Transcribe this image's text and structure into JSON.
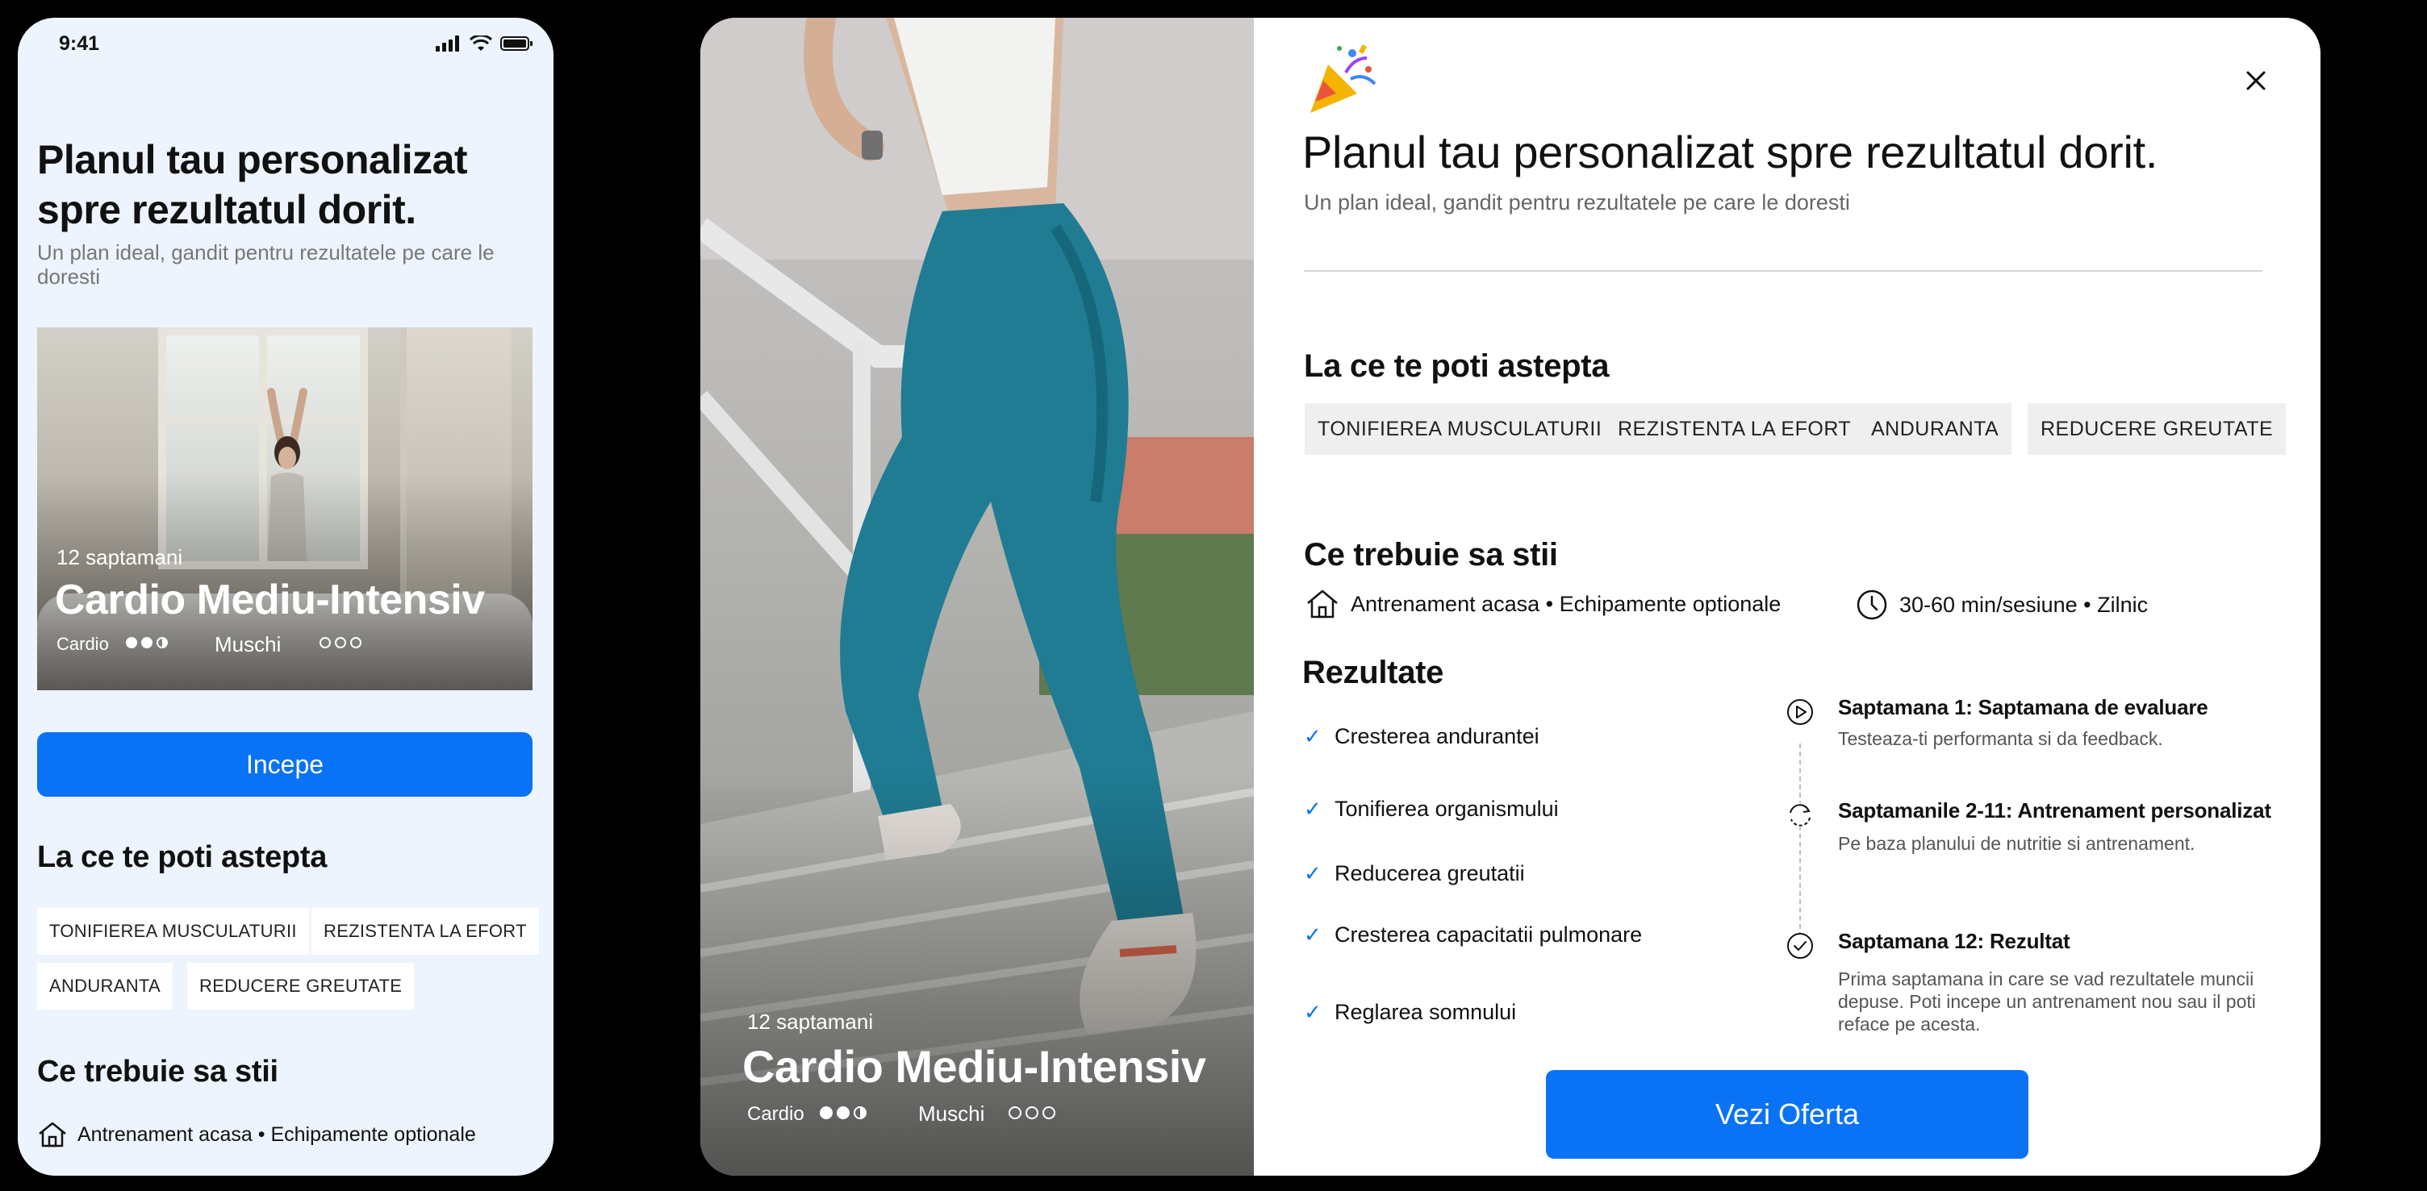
{
  "colors": {
    "accent": "#0a72f5",
    "phone_bg": "#eef4fd",
    "tag_bg": "#efefef"
  },
  "phone": {
    "status": {
      "time": "9:41",
      "icons": [
        "signal-icon",
        "wifi-icon",
        "battery-icon"
      ]
    },
    "title": "Planul tau personalizat spre rezultatul dorit.",
    "subtitle": "Un plan ideal, gandit pentru rezultatele pe care le doresti",
    "card": {
      "weeks": "12 saptamani",
      "plan_name": "Cardio Mediu-Intensiv",
      "cardio_label": "Cardio",
      "cardio_level": "2.5 of 3",
      "muscle_label": "Muschi",
      "muscle_level": "0 of 3"
    },
    "start_button": "Incepe",
    "expect_heading": "La ce te poti astepta",
    "tags": [
      "TONIFIEREA MUSCULATURII",
      "REZISTENTA LA EFORT",
      "ANDURANTA",
      "REDUCERE GREUTATE"
    ],
    "know_heading": "Ce trebuie sa stii",
    "info_line": "Antrenament acasa • Echipamente optionale"
  },
  "tablet": {
    "hero": {
      "weeks": "12 saptamani",
      "plan_name": "Cardio Mediu-Intensiv",
      "cardio_label": "Cardio",
      "cardio_level": "2.5 of 3",
      "muscle_label": "Muschi",
      "muscle_level": "0 of 3"
    },
    "title": "Planul tau personalizat spre rezultatul dorit.",
    "subtitle": "Un plan ideal, gandit pentru rezultatele pe care le doresti",
    "expect_heading": "La ce te poti astepta",
    "tags": [
      "TONIFIEREA MUSCULATURII",
      "REZISTENTA LA EFORT",
      "ANDURANTA",
      "REDUCERE GREUTATE"
    ],
    "know_heading": "Ce trebuie sa stii",
    "info_location": "Antrenament acasa • Echipamente optionale",
    "info_duration": "30-60 min/sesiune  • Zilnic",
    "results_heading": "Rezultate",
    "results": [
      "Cresterea andurantei",
      "Tonifierea organismului",
      "Reducerea greutatii",
      "Cresterea capacitatii pulmonare",
      "Reglarea somnului"
    ],
    "timeline": [
      {
        "title": "Saptamana 1: Saptamana de evaluare",
        "text": "Testeaza-ti performanta si da feedback."
      },
      {
        "title": "Saptamanile 2-11: Antrenament personalizat",
        "text": "Pe baza planului de nutritie si antrenament."
      },
      {
        "title": "Saptamana 12: Rezultat",
        "text": "Prima saptamana in care se vad rezultatele muncii depuse. Poti incepe un antrenament nou sau il poti reface pe acesta."
      }
    ],
    "offer_button": "Vezi Oferta"
  }
}
